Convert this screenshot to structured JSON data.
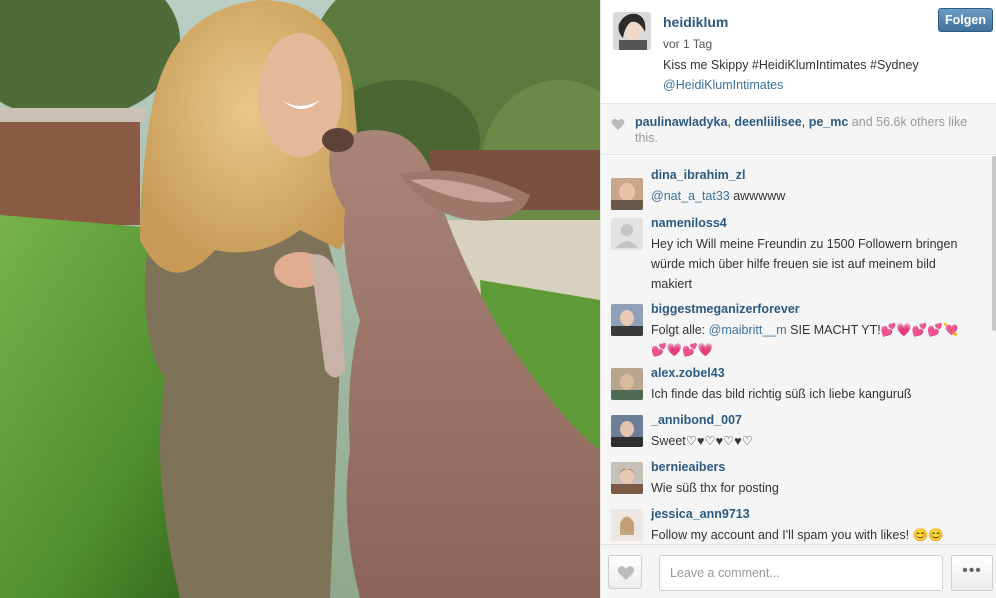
{
  "post": {
    "owner": "heidiklum",
    "time": "vor 1 Tag",
    "caption": "Kiss me Skippy #HeidiKlumIntimates #Sydney",
    "caption_mention": "@HeidiKlumIntimates",
    "follow_label": "Folgen"
  },
  "likes": {
    "user1": "paulinawladyka",
    "sep1": ", ",
    "user2": "deenliilisee",
    "sep2": ", ",
    "user3": "pe_mc",
    "rest": " and 56.6k others like this."
  },
  "comments": [
    {
      "user": "dina_ibrahim_zl",
      "mention": "@nat_a_tat33",
      "text": " awwwww"
    },
    {
      "user": "nameniloss4",
      "text": "Hey ich Will meine Freundin zu 1500 Followern bringen würde mich über hilfe freuen sie ist auf meinem bild makiert"
    },
    {
      "user": "biggestmeganizerforever",
      "text": "Folgt alle: ",
      "mention": "@maibritt__m",
      "text2": " SIE MACHT YT!",
      "hearts": "💕💗💕💕💘💕💗💕💗"
    },
    {
      "user": "alex.zobel43",
      "text": "Ich finde das bild richtig süß ich liebe kanguruß"
    },
    {
      "user": "_annibond_007",
      "text": "Sweet♡♥♡♥♡♥♡"
    },
    {
      "user": "bernieaibers",
      "text": "Wie süß thx for posting"
    },
    {
      "user": "jessica_ann9713",
      "text": "Follow my account and I'll spam you with likes! 😊😊"
    }
  ],
  "footer": {
    "comment_placeholder": "Leave a comment...",
    "more_label": "•••"
  },
  "icons": {
    "like": "heart-icon",
    "likes_row": "heart-icon",
    "more": "ellipsis-icon"
  },
  "colors": {
    "link": "#2b5a83",
    "follow_button": "#3f729b",
    "panel_bg": "#f5f5f5"
  }
}
